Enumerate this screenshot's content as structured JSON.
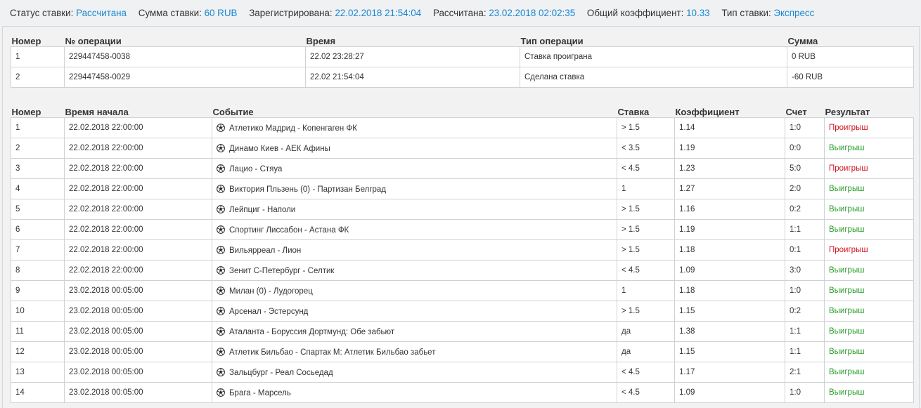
{
  "summary": {
    "status_label": "Статус ставки:",
    "status_value": "Рассчитана",
    "amount_label": "Сумма ставки:",
    "amount_value": "60 RUB",
    "registered_label": "Зарегистрирована:",
    "registered_value": "22.02.2018 21:54:04",
    "settled_label": "Рассчитана:",
    "settled_value": "23.02.2018 02:02:35",
    "odds_label": "Общий коэффициент:",
    "odds_value": "10.33",
    "type_label": "Тип ставки:",
    "type_value": "Экспресс"
  },
  "operations": {
    "headers": [
      "Номер",
      "№ операции",
      "Время",
      "Тип операции",
      "Сумма"
    ],
    "rows": [
      {
        "num": "1",
        "op": "229447458-0038",
        "time": "22.02 23:28:27",
        "type": "Ставка проиграна",
        "sum": "0 RUB"
      },
      {
        "num": "2",
        "op": "229447458-0029",
        "time": "22.02 21:54:04",
        "type": "Сделана ставка",
        "sum": "-60 RUB"
      }
    ]
  },
  "legs": {
    "headers": [
      "Номер",
      "Время начала",
      "Событие",
      "Ставка",
      "Коэффициент",
      "Счет",
      "Результат"
    ],
    "event_icon": "soccer-ball-icon",
    "rows": [
      {
        "num": "1",
        "start": "22.02.2018 22:00:00",
        "event": "Атлетико Мадрид - Копенгаген ФК",
        "bet": "> 1.5",
        "odds": "1.14",
        "score": "1:0",
        "result": "Проигрыш",
        "outcome": "loss"
      },
      {
        "num": "2",
        "start": "22.02.2018 22:00:00",
        "event": "Динамо Киев - АЕК Афины",
        "bet": "< 3.5",
        "odds": "1.19",
        "score": "0:0",
        "result": "Выигрыш",
        "outcome": "win"
      },
      {
        "num": "3",
        "start": "22.02.2018 22:00:00",
        "event": "Лацио - Стяуа",
        "bet": "< 4.5",
        "odds": "1.23",
        "score": "5:0",
        "result": "Проигрыш",
        "outcome": "loss"
      },
      {
        "num": "4",
        "start": "22.02.2018 22:00:00",
        "event": "Виктория Пльзень (0) - Партизан Белград",
        "bet": "1",
        "odds": "1.27",
        "score": "2:0",
        "result": "Выигрыш",
        "outcome": "win"
      },
      {
        "num": "5",
        "start": "22.02.2018 22:00:00",
        "event": "Лейпциг - Наполи",
        "bet": "> 1.5",
        "odds": "1.16",
        "score": "0:2",
        "result": "Выигрыш",
        "outcome": "win"
      },
      {
        "num": "6",
        "start": "22.02.2018 22:00:00",
        "event": "Спортинг Лиссабон - Астана ФК",
        "bet": "> 1.5",
        "odds": "1.19",
        "score": "1:1",
        "result": "Выигрыш",
        "outcome": "win"
      },
      {
        "num": "7",
        "start": "22.02.2018 22:00:00",
        "event": "Вильярреал - Лион",
        "bet": "> 1.5",
        "odds": "1.18",
        "score": "0:1",
        "result": "Проигрыш",
        "outcome": "loss"
      },
      {
        "num": "8",
        "start": "22.02.2018 22:00:00",
        "event": "Зенит С-Петербург - Селтик",
        "bet": "< 4.5",
        "odds": "1.09",
        "score": "3:0",
        "result": "Выигрыш",
        "outcome": "win"
      },
      {
        "num": "9",
        "start": "23.02.2018 00:05:00",
        "event": "Милан (0) - Лудогорец",
        "bet": "1",
        "odds": "1.18",
        "score": "1:0",
        "result": "Выигрыш",
        "outcome": "win"
      },
      {
        "num": "10",
        "start": "23.02.2018 00:05:00",
        "event": "Арсенал - Эстерсунд",
        "bet": "> 1.5",
        "odds": "1.15",
        "score": "0:2",
        "result": "Выигрыш",
        "outcome": "win"
      },
      {
        "num": "11",
        "start": "23.02.2018 00:05:00",
        "event": "Аталанта - Боруссия Дортмунд: Обе забьют",
        "bet": "да",
        "odds": "1.38",
        "score": "1:1",
        "result": "Выигрыш",
        "outcome": "win"
      },
      {
        "num": "12",
        "start": "23.02.2018 00:05:00",
        "event": "Атлетик Бильбао - Спартак М: Атлетик Бильбао забьет",
        "bet": "да",
        "odds": "1.15",
        "score": "1:1",
        "result": "Выигрыш",
        "outcome": "win"
      },
      {
        "num": "13",
        "start": "23.02.2018 00:05:00",
        "event": "Зальцбург - Реал Сосьедад",
        "bet": "< 4.5",
        "odds": "1.17",
        "score": "2:1",
        "result": "Выигрыш",
        "outcome": "win"
      },
      {
        "num": "14",
        "start": "23.02.2018 00:05:00",
        "event": "Брага - Марсель",
        "bet": "< 4.5",
        "odds": "1.09",
        "score": "1:0",
        "result": "Выигрыш",
        "outcome": "win"
      }
    ]
  },
  "colors": {
    "accent": "#1a87d0",
    "win": "#2a9b2a",
    "loss": "#d4121f"
  }
}
